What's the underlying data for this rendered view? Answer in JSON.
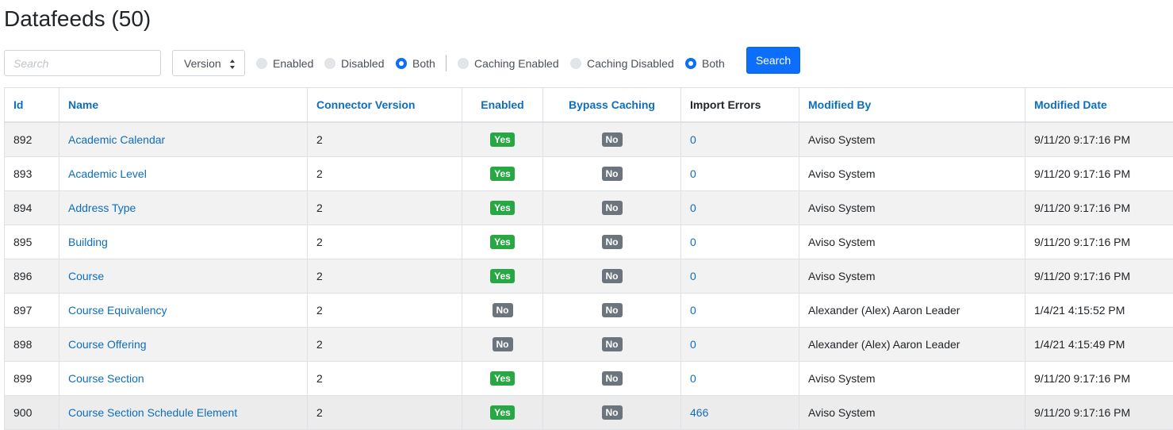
{
  "page": {
    "title": "Datafeeds (50)"
  },
  "filters": {
    "search_placeholder": "Search",
    "version_select": "Version",
    "status_radios": [
      {
        "label": "Enabled",
        "checked": false
      },
      {
        "label": "Disabled",
        "checked": false
      },
      {
        "label": "Both",
        "checked": true
      }
    ],
    "caching_radios": [
      {
        "label": "Caching Enabled",
        "checked": false
      },
      {
        "label": "Caching Disabled",
        "checked": false
      },
      {
        "label": "Both",
        "checked": true
      }
    ],
    "search_button": "Search"
  },
  "colors": {
    "accent": "#0d6efd",
    "link": "#0d6ebd",
    "yes_badge": "#28a745",
    "no_badge": "#6c757d"
  },
  "table": {
    "columns": [
      "Id",
      "Name",
      "Connector Version",
      "Enabled",
      "Bypass Caching",
      "Import Errors",
      "Modified By",
      "Modified Date"
    ],
    "rows": [
      {
        "id": "892",
        "name": "Academic Calendar",
        "version": "2",
        "enabled": "Yes",
        "bypass": "No",
        "errors": "0",
        "modified_by": "Aviso System",
        "modified_date": "9/11/20 9:17:16 PM"
      },
      {
        "id": "893",
        "name": "Academic Level",
        "version": "2",
        "enabled": "Yes",
        "bypass": "No",
        "errors": "0",
        "modified_by": "Aviso System",
        "modified_date": "9/11/20 9:17:16 PM"
      },
      {
        "id": "894",
        "name": "Address Type",
        "version": "2",
        "enabled": "Yes",
        "bypass": "No",
        "errors": "0",
        "modified_by": "Aviso System",
        "modified_date": "9/11/20 9:17:16 PM"
      },
      {
        "id": "895",
        "name": "Building",
        "version": "2",
        "enabled": "Yes",
        "bypass": "No",
        "errors": "0",
        "modified_by": "Aviso System",
        "modified_date": "9/11/20 9:17:16 PM"
      },
      {
        "id": "896",
        "name": "Course",
        "version": "2",
        "enabled": "Yes",
        "bypass": "No",
        "errors": "0",
        "modified_by": "Aviso System",
        "modified_date": "9/11/20 9:17:16 PM"
      },
      {
        "id": "897",
        "name": "Course Equivalency",
        "version": "2",
        "enabled": "No",
        "bypass": "No",
        "errors": "0",
        "modified_by": "Alexander (Alex) Aaron Leader",
        "modified_date": "1/4/21 4:15:52 PM"
      },
      {
        "id": "898",
        "name": "Course Offering",
        "version": "2",
        "enabled": "No",
        "bypass": "No",
        "errors": "0",
        "modified_by": "Alexander (Alex) Aaron Leader",
        "modified_date": "1/4/21 4:15:49 PM"
      },
      {
        "id": "899",
        "name": "Course Section",
        "version": "2",
        "enabled": "Yes",
        "bypass": "No",
        "errors": "0",
        "modified_by": "Aviso System",
        "modified_date": "9/11/20 9:17:16 PM"
      },
      {
        "id": "900",
        "name": "Course Section Schedule Element",
        "version": "2",
        "enabled": "Yes",
        "bypass": "No",
        "errors": "466",
        "modified_by": "Aviso System",
        "modified_date": "9/11/20 9:17:16 PM"
      }
    ]
  }
}
